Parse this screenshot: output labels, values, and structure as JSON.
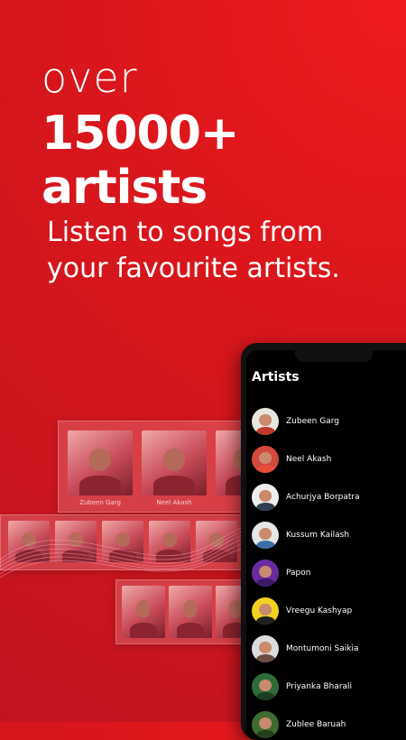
{
  "headline": {
    "line1": "over",
    "line2": "15000+ artists"
  },
  "tagline": "Listen to songs from your favourite artists.",
  "collage": {
    "labels": [
      "Zubeen Garg",
      "Neel Akash"
    ]
  },
  "phone": {
    "title": "Artists",
    "artists": [
      {
        "name": "Zubeen Garg",
        "bg": "#e9e6e0",
        "body": "#c0392b"
      },
      {
        "name": "Neel Akash",
        "bg": "#d24a3d",
        "body": "#e74c3c"
      },
      {
        "name": "Achurjya Borpatra",
        "bg": "#eeeeee",
        "body": "#2c3e50"
      },
      {
        "name": "Kussum Kailash",
        "bg": "#e6e6e6",
        "body": "#3a6ea5"
      },
      {
        "name": "Papon",
        "bg": "#6a2ba0",
        "body": "#3b1a66"
      },
      {
        "name": "Vreegu Kashyap",
        "bg": "#f2d21f",
        "body": "#1f1f1f"
      },
      {
        "name": "Montumoni Saikia",
        "bg": "#dcdcdc",
        "body": "#6d4c41"
      },
      {
        "name": "Priyanka Bharali",
        "bg": "#2f6b3a",
        "body": "#1b3d22"
      },
      {
        "name": "Zublee Baruah",
        "bg": "#3e6b2f",
        "body": "#23401a"
      }
    ]
  }
}
